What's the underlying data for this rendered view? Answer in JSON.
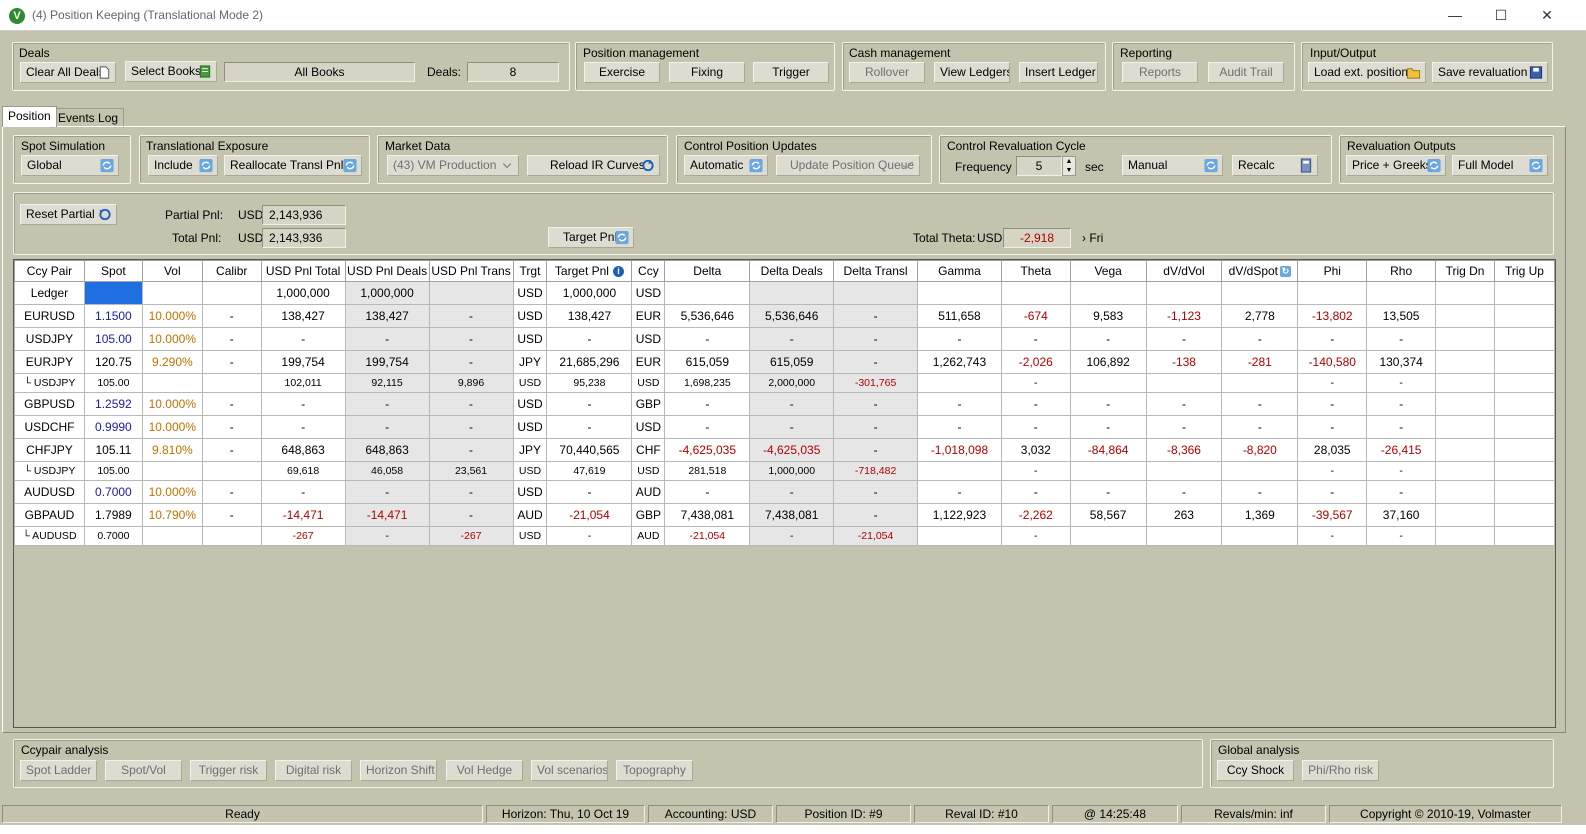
{
  "window": {
    "title": "(4) Position Keeping  (Translational Mode 2)",
    "minimize": "—",
    "maximize": "☐",
    "close": "✕"
  },
  "deals": {
    "legend": "Deals",
    "clear_all": "Clear All Deals",
    "select_books": "Select Books",
    "books_value": "All Books",
    "deals_label": "Deals:",
    "deals_count": "8"
  },
  "position_mgmt": {
    "legend": "Position management",
    "exercise": "Exercise",
    "fixing": "Fixing",
    "trigger": "Trigger"
  },
  "cash_mgmt": {
    "legend": "Cash management",
    "rollover": "Rollover",
    "view_ledgers": "View Ledgers",
    "insert_ledger": "Insert Ledger"
  },
  "reporting": {
    "legend": "Reporting",
    "reports": "Reports",
    "audit_trail": "Audit Trail"
  },
  "io": {
    "legend": "Input/Output",
    "load": "Load ext. position",
    "save": "Save revaluation"
  },
  "tabs": [
    {
      "label": "Position"
    },
    {
      "label": "Events Log"
    }
  ],
  "spot_sim": {
    "legend": "Spot Simulation",
    "value": "Global"
  },
  "transl": {
    "legend": "Translational Exposure",
    "include": "Include",
    "realloc": "Reallocate Transl Pnl"
  },
  "market": {
    "legend": "Market Data",
    "source": "(43) VM Production",
    "reload": "Reload IR Curves"
  },
  "cpu": {
    "legend": "Control Position Updates",
    "mode": "Automatic",
    "update_queue": "Update Position Queue"
  },
  "crc": {
    "legend": "Control Revaluation Cycle",
    "freq_label": "Frequency",
    "freq_value": "5",
    "sec": "sec",
    "manual": "Manual",
    "recalc": "Recalc"
  },
  "outputs": {
    "legend": "Revaluation Outputs",
    "price_greeks": "Price + Greeks",
    "full_model": "Full Model"
  },
  "pnl": {
    "reset": "Reset Partial",
    "partial_label": "Partial Pnl:",
    "total_label": "Total Pnl:",
    "ccy1": "USD",
    "ccy2": "USD",
    "partial_value": "2,143,936",
    "total_value": "2,143,936",
    "target": "Target Pnl",
    "theta_label": "Total Theta:",
    "theta_ccy": "USD",
    "theta_value": "-2,918",
    "theta_day": "› Fri"
  },
  "grid": {
    "headers": [
      "Ccy Pair",
      "Spot",
      "Vol",
      "Calibr",
      "USD Pnl Total",
      "USD Pnl Deals",
      "USD Pnl Trans",
      "Trgt",
      "Target Pnl",
      "Ccy",
      "Delta",
      "Delta Deals",
      "Delta Transl",
      "Gamma",
      "Theta",
      "Vega",
      "dV/dVol",
      "dV/dSpot",
      "Phi",
      "Rho",
      "Trig Dn",
      "Trig Up"
    ],
    "rows": [
      {
        "t": "m",
        "c": [
          "Ledger",
          "",
          "",
          "",
          "1,000,000",
          "1,000,000",
          "",
          "USD",
          "1,000,000",
          "USD",
          "",
          "",
          "",
          "",
          "",
          "",
          "",
          "",
          "",
          "",
          "",
          ""
        ]
      },
      {
        "t": "m",
        "c": [
          "EURUSD",
          "1.1500",
          "10.000%",
          "-",
          "138,427",
          "138,427",
          "-",
          "USD",
          "138,427",
          "EUR",
          "5,536,646",
          "5,536,646",
          "-",
          "511,658",
          "-674",
          "9,583",
          "-1,123",
          "2,778",
          "-13,802",
          "13,505",
          "",
          ""
        ]
      },
      {
        "t": "m",
        "c": [
          "USDJPY",
          "105.00",
          "10.000%",
          "-",
          "-",
          "-",
          "-",
          "USD",
          "-",
          "USD",
          "-",
          "-",
          "-",
          "-",
          "-",
          "-",
          "-",
          "-",
          "-",
          "-",
          "",
          ""
        ]
      },
      {
        "t": "m",
        "c": [
          "EURJPY",
          "120.75",
          "9.290%",
          "-",
          "199,754",
          "199,754",
          "-",
          "JPY",
          "21,685,296",
          "EUR",
          "615,059",
          "615,059",
          "-",
          "1,262,743",
          "-2,026",
          "106,892",
          "-138",
          "-281",
          "-140,580",
          "130,374",
          "",
          ""
        ]
      },
      {
        "t": "s",
        "c": [
          "└ USDJPY",
          "105.00",
          "",
          "",
          "102,011",
          "92,115",
          "9,896",
          "USD",
          "95,238",
          "USD",
          "1,698,235",
          "2,000,000",
          "-301,765",
          "",
          "-",
          "",
          "",
          "",
          "-",
          "-",
          "",
          ""
        ]
      },
      {
        "t": "m",
        "c": [
          "GBPUSD",
          "1.2592",
          "10.000%",
          "-",
          "-",
          "-",
          "-",
          "USD",
          "-",
          "GBP",
          "-",
          "-",
          "-",
          "-",
          "-",
          "-",
          "-",
          "-",
          "-",
          "-",
          "",
          ""
        ]
      },
      {
        "t": "m",
        "c": [
          "USDCHF",
          "0.9990",
          "10.000%",
          "-",
          "-",
          "-",
          "-",
          "USD",
          "-",
          "USD",
          "-",
          "-",
          "-",
          "-",
          "-",
          "-",
          "-",
          "-",
          "-",
          "-",
          "",
          ""
        ]
      },
      {
        "t": "m",
        "c": [
          "CHFJPY",
          "105.11",
          "9.810%",
          "-",
          "648,863",
          "648,863",
          "-",
          "JPY",
          "70,440,565",
          "CHF",
          "-4,625,035",
          "-4,625,035",
          "-",
          "-1,018,098",
          "3,032",
          "-84,864",
          "-8,366",
          "-8,820",
          "28,035",
          "-26,415",
          "",
          ""
        ]
      },
      {
        "t": "s",
        "c": [
          "└ USDJPY",
          "105.00",
          "",
          "",
          "69,618",
          "46,058",
          "23,561",
          "USD",
          "47,619",
          "USD",
          "281,518",
          "1,000,000",
          "-718,482",
          "",
          "-",
          "",
          "",
          "",
          "-",
          "-",
          "",
          ""
        ]
      },
      {
        "t": "m",
        "c": [
          "AUDUSD",
          "0.7000",
          "10.000%",
          "-",
          "-",
          "-",
          "-",
          "USD",
          "-",
          "AUD",
          "-",
          "-",
          "-",
          "-",
          "-",
          "-",
          "-",
          "-",
          "-",
          "-",
          "",
          ""
        ]
      },
      {
        "t": "m",
        "c": [
          "GBPAUD",
          "1.7989",
          "10.790%",
          "-",
          "-14,471",
          "-14,471",
          "-",
          "AUD",
          "-21,054",
          "GBP",
          "7,438,081",
          "7,438,081",
          "-",
          "1,122,923",
          "-2,262",
          "58,567",
          "263",
          "1,369",
          "-39,567",
          "37,160",
          "",
          ""
        ]
      },
      {
        "t": "s",
        "c": [
          "└ AUDUSD",
          "0.7000",
          "",
          "",
          "-267",
          "-",
          "-267",
          "USD",
          "-",
          "AUD",
          "-21,054",
          "-",
          "-21,054",
          "",
          "-",
          "",
          "",
          "",
          "-",
          "-",
          "",
          ""
        ]
      }
    ]
  },
  "ccypair": {
    "legend": "Ccypair analysis",
    "buttons": [
      "Spot Ladder",
      "Spot/Vol",
      "Trigger risk",
      "Digital risk",
      "Horizon Shift",
      "Vol Hedge",
      "Vol scenarios",
      "Topography"
    ]
  },
  "global": {
    "legend": "Global analysis",
    "buttons": [
      "Ccy Shock",
      "Phi/Rho risk"
    ]
  },
  "status": {
    "ready": "Ready",
    "horizon": "Horizon: Thu, 10 Oct 19",
    "accounting": "Accounting: USD",
    "position": "Position ID: #9",
    "reval": "Reval ID: #10",
    "time": "@ 14:25:48",
    "revals": "Revals/min: inf",
    "copyright": "Copyright © 2010-19, Volmaster"
  },
  "colors": {
    "panel": "#c4c3ad",
    "negative": "#b00000",
    "spot_blue": "#1a1aa8",
    "vol_orange": "#c07000",
    "selected": "#1f6fe0"
  }
}
